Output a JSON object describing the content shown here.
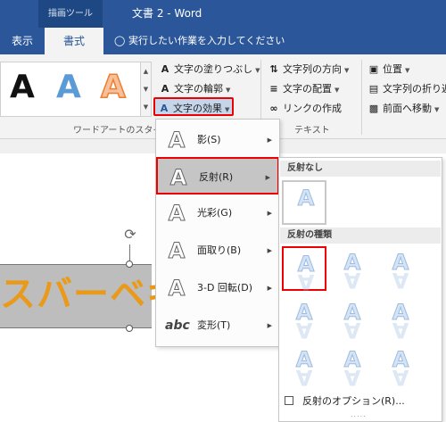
{
  "title_bar": {
    "context_tab": "描画ツール",
    "doc_title": "文書 2 - Word"
  },
  "tabs": {
    "view": "表示",
    "format": "書式"
  },
  "tell_me": "実行したい作業を入力してください",
  "ribbon": {
    "wordart_group": {
      "sample_glyph": "A",
      "fill": "文字の塗りつぶし",
      "outline": "文字の輪郭",
      "effects": "文字の効果",
      "label": "ワードアートのスタイル"
    },
    "text_group": {
      "direction": "文字列の方向",
      "align": "文字の配置",
      "link": "リンクの作成",
      "label": "テキスト"
    },
    "arrange_group": {
      "position": "位置",
      "wrap": "文字列の折り返",
      "bring_forward": "前面へ移動"
    }
  },
  "document": {
    "wordart_text": "スバーベキ"
  },
  "effects_menu": {
    "items": [
      {
        "glyph": "A",
        "label": "影(S)"
      },
      {
        "glyph": "A",
        "label": "反射(R)"
      },
      {
        "glyph": "A",
        "label": "光彩(G)"
      },
      {
        "glyph": "A",
        "label": "面取り(B)"
      },
      {
        "glyph": "A",
        "label": "3-D 回転(D)"
      },
      {
        "glyph": "abc",
        "label": "変形(T)"
      }
    ]
  },
  "reflection_submenu": {
    "no_reflection_header": "反射なし",
    "variations_header": "反射の種類",
    "cell_glyph": "A",
    "options": "反射のオプション(R)...",
    "grip": "....."
  }
}
